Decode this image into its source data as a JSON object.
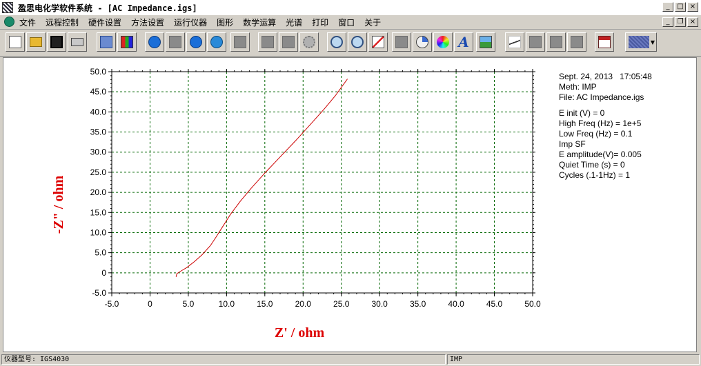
{
  "window": {
    "title": "盈思电化学软件系统 - [AC Impedance.igs]",
    "buttons": [
      "_",
      "□",
      "×"
    ],
    "mdi_buttons": [
      "_",
      "❐",
      "×"
    ]
  },
  "menu": {
    "items": [
      "文件",
      "远程控制",
      "硬件设置",
      "方法设置",
      "运行仪器",
      "图形",
      "数学运算",
      "光谱",
      "打印",
      "窗口",
      "关于"
    ]
  },
  "toolbar": {
    "icons": [
      "new-file-icon",
      "open-folder-icon",
      "save-icon",
      "print-icon",
      "copy-icon",
      "report-icon",
      "run-icon",
      "pause-icon",
      "stop-icon",
      "refresh-icon",
      "disabled-icon",
      "disabled-icon",
      "disabled-icon",
      "settings-gear-icon",
      "zoom-out-icon",
      "zoom-in-icon",
      "graph-icon",
      "disabled-icon",
      "pie-chart-icon",
      "color-wheel-icon",
      "text-font-icon",
      "export-image-icon",
      "curve-icon",
      "disabled-icon",
      "disabled-icon",
      "disabled-icon",
      "calendar-icon",
      "color-select-icon"
    ]
  },
  "info": {
    "date": "Sept. 24, 2013   17:05:48",
    "meth": "Meth: IMP",
    "file": "File: AC Impedance.igs",
    "params": [
      "E init (V) = 0",
      "High Freq (Hz) = 1e+5",
      "Low Freq (Hz) = 0.1",
      "Imp SF",
      "E amplitude(V)= 0.005",
      "Quiet Time (s) = 0",
      "Cycles (.1-1Hz) = 1"
    ]
  },
  "status": {
    "instrument": "仪器型号: IGS4030",
    "mode": "IMP"
  },
  "colors": {
    "curve": "#cc0000",
    "axis_label": "#dd0000",
    "grid": "#006600"
  },
  "chart_data": {
    "type": "line",
    "xlabel": "Z' / ohm",
    "ylabel": "-Z\" / ohm",
    "xlim": [
      -5.0,
      50.0
    ],
    "ylim": [
      -5.0,
      50.0
    ],
    "xticks": [
      "-5.0",
      "0",
      "5.0",
      "10.0",
      "15.0",
      "20.0",
      "25.0",
      "30.0",
      "35.0",
      "40.0",
      "45.0",
      "50.0"
    ],
    "yticks": [
      "50.0",
      "45.0",
      "40.0",
      "35.0",
      "30.0",
      "25.0",
      "20.0",
      "15.0",
      "10.0",
      "5.0",
      "0",
      "-5.0"
    ],
    "grid": true,
    "series": [
      {
        "x": [
          3.4,
          3.5,
          4.0,
          4.8,
          5.8,
          6.8,
          7.9,
          8.6,
          9.5,
          10.5,
          11.8,
          13.2,
          15.0,
          17.0,
          19.0,
          21.0,
          22.8,
          24.2,
          25.8
        ],
        "y": [
          -1.0,
          -0.2,
          0.4,
          1.3,
          2.8,
          4.5,
          6.8,
          8.8,
          11.5,
          14.5,
          17.8,
          21.0,
          24.8,
          28.8,
          32.8,
          37.0,
          40.8,
          44.0,
          48.2
        ]
      }
    ]
  }
}
